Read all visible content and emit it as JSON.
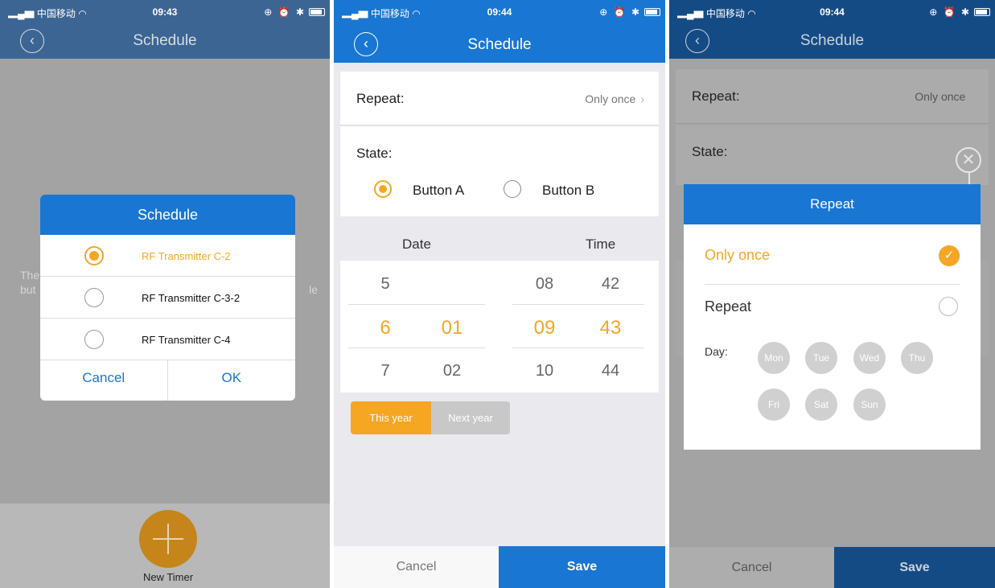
{
  "status": {
    "carrier": "中国移动",
    "time1": "09:43",
    "time2": "09:44",
    "time3": "09:44",
    "icons": "⊕ ⏰ ✱"
  },
  "panel1": {
    "title": "Schedule",
    "hint_left1": "The",
    "hint_right1": "le",
    "hint_left2": "but",
    "dialog": {
      "title": "Schedule",
      "items": [
        {
          "label": "RF Transmitter C-2",
          "selected": true
        },
        {
          "label": "RF Transmitter C-3-2",
          "selected": false
        },
        {
          "label": "RF Transmitter C-4",
          "selected": false
        }
      ],
      "cancel": "Cancel",
      "ok": "OK"
    },
    "new_timer": "New Timer"
  },
  "panel2": {
    "title": "Schedule",
    "repeat_label": "Repeat:",
    "repeat_value": "Only once",
    "state_label": "State:",
    "button_a": "Button A",
    "button_b": "Button B",
    "date_head": "Date",
    "time_head": "Time",
    "picker": {
      "day": [
        "5",
        "6",
        "7"
      ],
      "month": [
        "",
        "01",
        "02"
      ],
      "hour": [
        "08",
        "09",
        "10"
      ],
      "minute": [
        "42",
        "43",
        "44"
      ]
    },
    "this_year": "This year",
    "next_year": "Next year",
    "cancel": "Cancel",
    "save": "Save"
  },
  "panel3": {
    "title": "Schedule",
    "repeat_label": "Repeat:",
    "repeat_value": "Only once",
    "state_label": "State:",
    "dialog": {
      "title": "Repeat",
      "only_once": "Only once",
      "repeat": "Repeat",
      "day_label": "Day:",
      "days": [
        "Mon",
        "Tue",
        "Wed",
        "Thu",
        "Fri",
        "Sat",
        "Sun"
      ]
    },
    "cancel": "Cancel",
    "save": "Save"
  },
  "colors": {
    "accent": "#f5a623",
    "primary": "#1976d2"
  }
}
